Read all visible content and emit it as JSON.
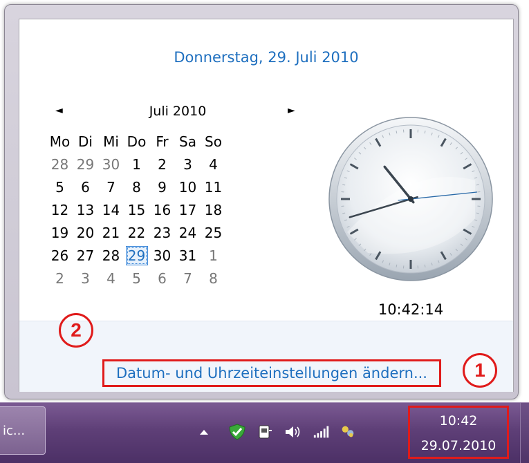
{
  "flyout": {
    "date_header": "Donnerstag, 29. Juli 2010",
    "month_title": "Juli 2010",
    "prev_month": "◄",
    "next_month": "►",
    "weekdays": [
      "Mo",
      "Di",
      "Mi",
      "Do",
      "Fr",
      "Sa",
      "So"
    ],
    "weeks": [
      [
        "28",
        "29",
        "30",
        "1",
        "2",
        "3",
        "4"
      ],
      [
        "5",
        "6",
        "7",
        "8",
        "9",
        "10",
        "11"
      ],
      [
        "12",
        "13",
        "14",
        "15",
        "16",
        "17",
        "18"
      ],
      [
        "19",
        "20",
        "21",
        "22",
        "23",
        "24",
        "25"
      ],
      [
        "26",
        "27",
        "28",
        "29",
        "30",
        "31",
        "1"
      ],
      [
        "2",
        "3",
        "4",
        "5",
        "6",
        "7",
        "8"
      ]
    ],
    "selected_day": "29",
    "digital_time": "10:42:14",
    "analog_clock": {
      "hour": 10,
      "minute": 42,
      "second": 14
    },
    "change_settings_link": "Datum- und Uhrzeiteinstellungen ändern..."
  },
  "markers": {
    "one": "1",
    "two": "2"
  },
  "taskbar": {
    "task_button_label": "ic...",
    "tray_icons": [
      "show-hidden-icons-arrow-icon",
      "security-shield-check-icon",
      "power-plug-icon",
      "speaker-volume-icon",
      "network-signal-bars-icon",
      "users-messenger-icon"
    ],
    "time": "10:42",
    "date": "29.07.2010"
  },
  "colors": {
    "link_blue": "#1e6fbf",
    "highlight_red": "#e01b1b",
    "taskbar_purple": "#5e3f77"
  }
}
